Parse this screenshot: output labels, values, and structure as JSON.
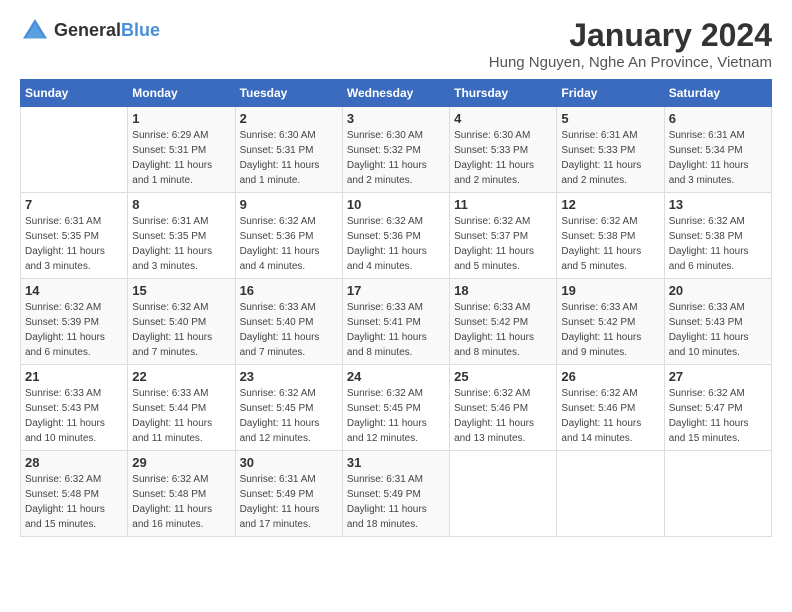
{
  "logo": {
    "text_general": "General",
    "text_blue": "Blue"
  },
  "header": {
    "month": "January 2024",
    "location": "Hung Nguyen, Nghe An Province, Vietnam"
  },
  "weekdays": [
    "Sunday",
    "Monday",
    "Tuesday",
    "Wednesday",
    "Thursday",
    "Friday",
    "Saturday"
  ],
  "weeks": [
    [
      {
        "day": "",
        "info": ""
      },
      {
        "day": "1",
        "info": "Sunrise: 6:29 AM\nSunset: 5:31 PM\nDaylight: 11 hours\nand 1 minute."
      },
      {
        "day": "2",
        "info": "Sunrise: 6:30 AM\nSunset: 5:31 PM\nDaylight: 11 hours\nand 1 minute."
      },
      {
        "day": "3",
        "info": "Sunrise: 6:30 AM\nSunset: 5:32 PM\nDaylight: 11 hours\nand 2 minutes."
      },
      {
        "day": "4",
        "info": "Sunrise: 6:30 AM\nSunset: 5:33 PM\nDaylight: 11 hours\nand 2 minutes."
      },
      {
        "day": "5",
        "info": "Sunrise: 6:31 AM\nSunset: 5:33 PM\nDaylight: 11 hours\nand 2 minutes."
      },
      {
        "day": "6",
        "info": "Sunrise: 6:31 AM\nSunset: 5:34 PM\nDaylight: 11 hours\nand 3 minutes."
      }
    ],
    [
      {
        "day": "7",
        "info": "Sunrise: 6:31 AM\nSunset: 5:35 PM\nDaylight: 11 hours\nand 3 minutes."
      },
      {
        "day": "8",
        "info": "Sunrise: 6:31 AM\nSunset: 5:35 PM\nDaylight: 11 hours\nand 3 minutes."
      },
      {
        "day": "9",
        "info": "Sunrise: 6:32 AM\nSunset: 5:36 PM\nDaylight: 11 hours\nand 4 minutes."
      },
      {
        "day": "10",
        "info": "Sunrise: 6:32 AM\nSunset: 5:36 PM\nDaylight: 11 hours\nand 4 minutes."
      },
      {
        "day": "11",
        "info": "Sunrise: 6:32 AM\nSunset: 5:37 PM\nDaylight: 11 hours\nand 5 minutes."
      },
      {
        "day": "12",
        "info": "Sunrise: 6:32 AM\nSunset: 5:38 PM\nDaylight: 11 hours\nand 5 minutes."
      },
      {
        "day": "13",
        "info": "Sunrise: 6:32 AM\nSunset: 5:38 PM\nDaylight: 11 hours\nand 6 minutes."
      }
    ],
    [
      {
        "day": "14",
        "info": "Sunrise: 6:32 AM\nSunset: 5:39 PM\nDaylight: 11 hours\nand 6 minutes."
      },
      {
        "day": "15",
        "info": "Sunrise: 6:32 AM\nSunset: 5:40 PM\nDaylight: 11 hours\nand 7 minutes."
      },
      {
        "day": "16",
        "info": "Sunrise: 6:33 AM\nSunset: 5:40 PM\nDaylight: 11 hours\nand 7 minutes."
      },
      {
        "day": "17",
        "info": "Sunrise: 6:33 AM\nSunset: 5:41 PM\nDaylight: 11 hours\nand 8 minutes."
      },
      {
        "day": "18",
        "info": "Sunrise: 6:33 AM\nSunset: 5:42 PM\nDaylight: 11 hours\nand 8 minutes."
      },
      {
        "day": "19",
        "info": "Sunrise: 6:33 AM\nSunset: 5:42 PM\nDaylight: 11 hours\nand 9 minutes."
      },
      {
        "day": "20",
        "info": "Sunrise: 6:33 AM\nSunset: 5:43 PM\nDaylight: 11 hours\nand 10 minutes."
      }
    ],
    [
      {
        "day": "21",
        "info": "Sunrise: 6:33 AM\nSunset: 5:43 PM\nDaylight: 11 hours\nand 10 minutes."
      },
      {
        "day": "22",
        "info": "Sunrise: 6:33 AM\nSunset: 5:44 PM\nDaylight: 11 hours\nand 11 minutes."
      },
      {
        "day": "23",
        "info": "Sunrise: 6:32 AM\nSunset: 5:45 PM\nDaylight: 11 hours\nand 12 minutes."
      },
      {
        "day": "24",
        "info": "Sunrise: 6:32 AM\nSunset: 5:45 PM\nDaylight: 11 hours\nand 12 minutes."
      },
      {
        "day": "25",
        "info": "Sunrise: 6:32 AM\nSunset: 5:46 PM\nDaylight: 11 hours\nand 13 minutes."
      },
      {
        "day": "26",
        "info": "Sunrise: 6:32 AM\nSunset: 5:46 PM\nDaylight: 11 hours\nand 14 minutes."
      },
      {
        "day": "27",
        "info": "Sunrise: 6:32 AM\nSunset: 5:47 PM\nDaylight: 11 hours\nand 15 minutes."
      }
    ],
    [
      {
        "day": "28",
        "info": "Sunrise: 6:32 AM\nSunset: 5:48 PM\nDaylight: 11 hours\nand 15 minutes."
      },
      {
        "day": "29",
        "info": "Sunrise: 6:32 AM\nSunset: 5:48 PM\nDaylight: 11 hours\nand 16 minutes."
      },
      {
        "day": "30",
        "info": "Sunrise: 6:31 AM\nSunset: 5:49 PM\nDaylight: 11 hours\nand 17 minutes."
      },
      {
        "day": "31",
        "info": "Sunrise: 6:31 AM\nSunset: 5:49 PM\nDaylight: 11 hours\nand 18 minutes."
      },
      {
        "day": "",
        "info": ""
      },
      {
        "day": "",
        "info": ""
      },
      {
        "day": "",
        "info": ""
      }
    ]
  ]
}
